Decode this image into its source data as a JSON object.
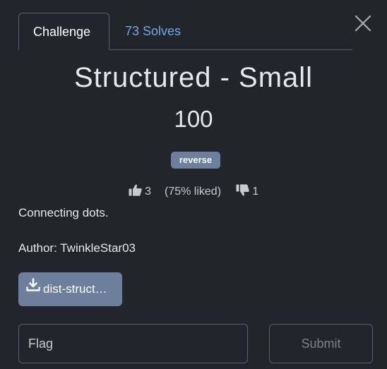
{
  "tabs": [
    {
      "label": "Challenge",
      "active": true
    },
    {
      "label": "73 Solves",
      "active": false
    }
  ],
  "challenge": {
    "title": "Structured - Small",
    "points": "100",
    "tag": "reverse",
    "likes": "3",
    "liked_pct": "(75% liked)",
    "dislikes": "1",
    "description": "Connecting dots.",
    "author": "Author: TwinkleStar03",
    "file_label": "dist-struct…"
  },
  "form": {
    "flag_placeholder": "Flag",
    "flag_value": "",
    "submit_label": "Submit"
  },
  "icons": {
    "close": "close-icon",
    "like": "thumbs-up-icon",
    "dislike": "thumbs-down-icon",
    "download": "download-icon"
  },
  "colors": {
    "background": "#22252b",
    "link": "#6ea8ea",
    "tag_bg": "#6c7f9c",
    "border": "#5a5f68"
  }
}
